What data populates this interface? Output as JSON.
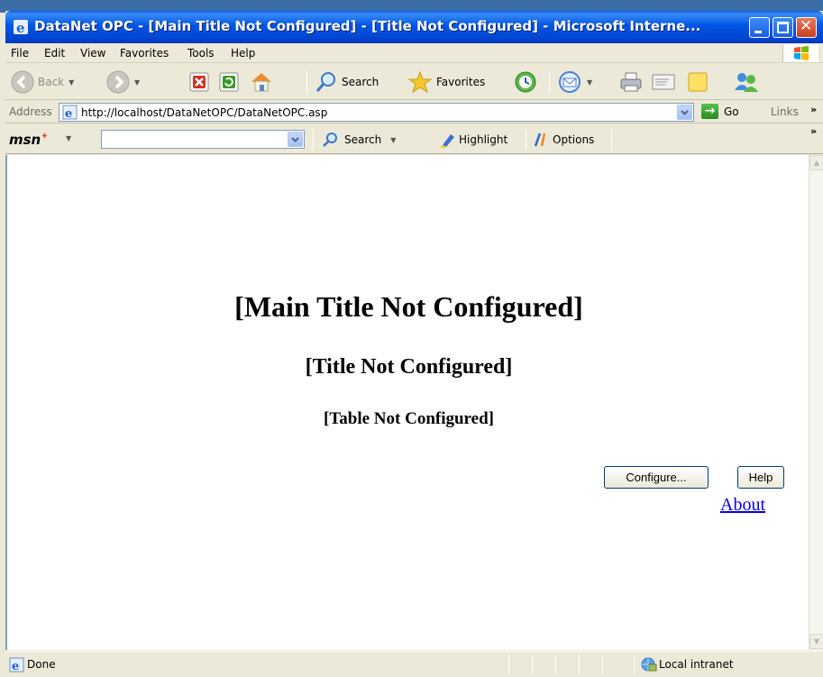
{
  "window": {
    "title": "DataNet OPC - [Main Title Not Configured] - [Title Not Configured] - Microsoft Interne..."
  },
  "menu": [
    "File",
    "Edit",
    "View",
    "Favorites",
    "Tools",
    "Help"
  ],
  "toolbar": {
    "back_label": "Back",
    "search_label": "Search",
    "favorites_label": "Favorites"
  },
  "address": {
    "label": "Address",
    "url": "http://localhost/DataNetOPC/DataNetOPC.asp",
    "go_label": "Go",
    "links_label": "Links"
  },
  "msn": {
    "logo": "msn",
    "search_value": "",
    "search_label": "Search",
    "highlight_label": "Highlight",
    "options_label": "Options"
  },
  "page": {
    "main_title": "[Main Title Not Configured]",
    "title": "[Title Not Configured]",
    "table": "[Table Not Configured]",
    "configure_button": "Configure...",
    "help_button": "Help",
    "about_link": "About"
  },
  "status": {
    "text": "Done",
    "zone": "Local intranet"
  }
}
